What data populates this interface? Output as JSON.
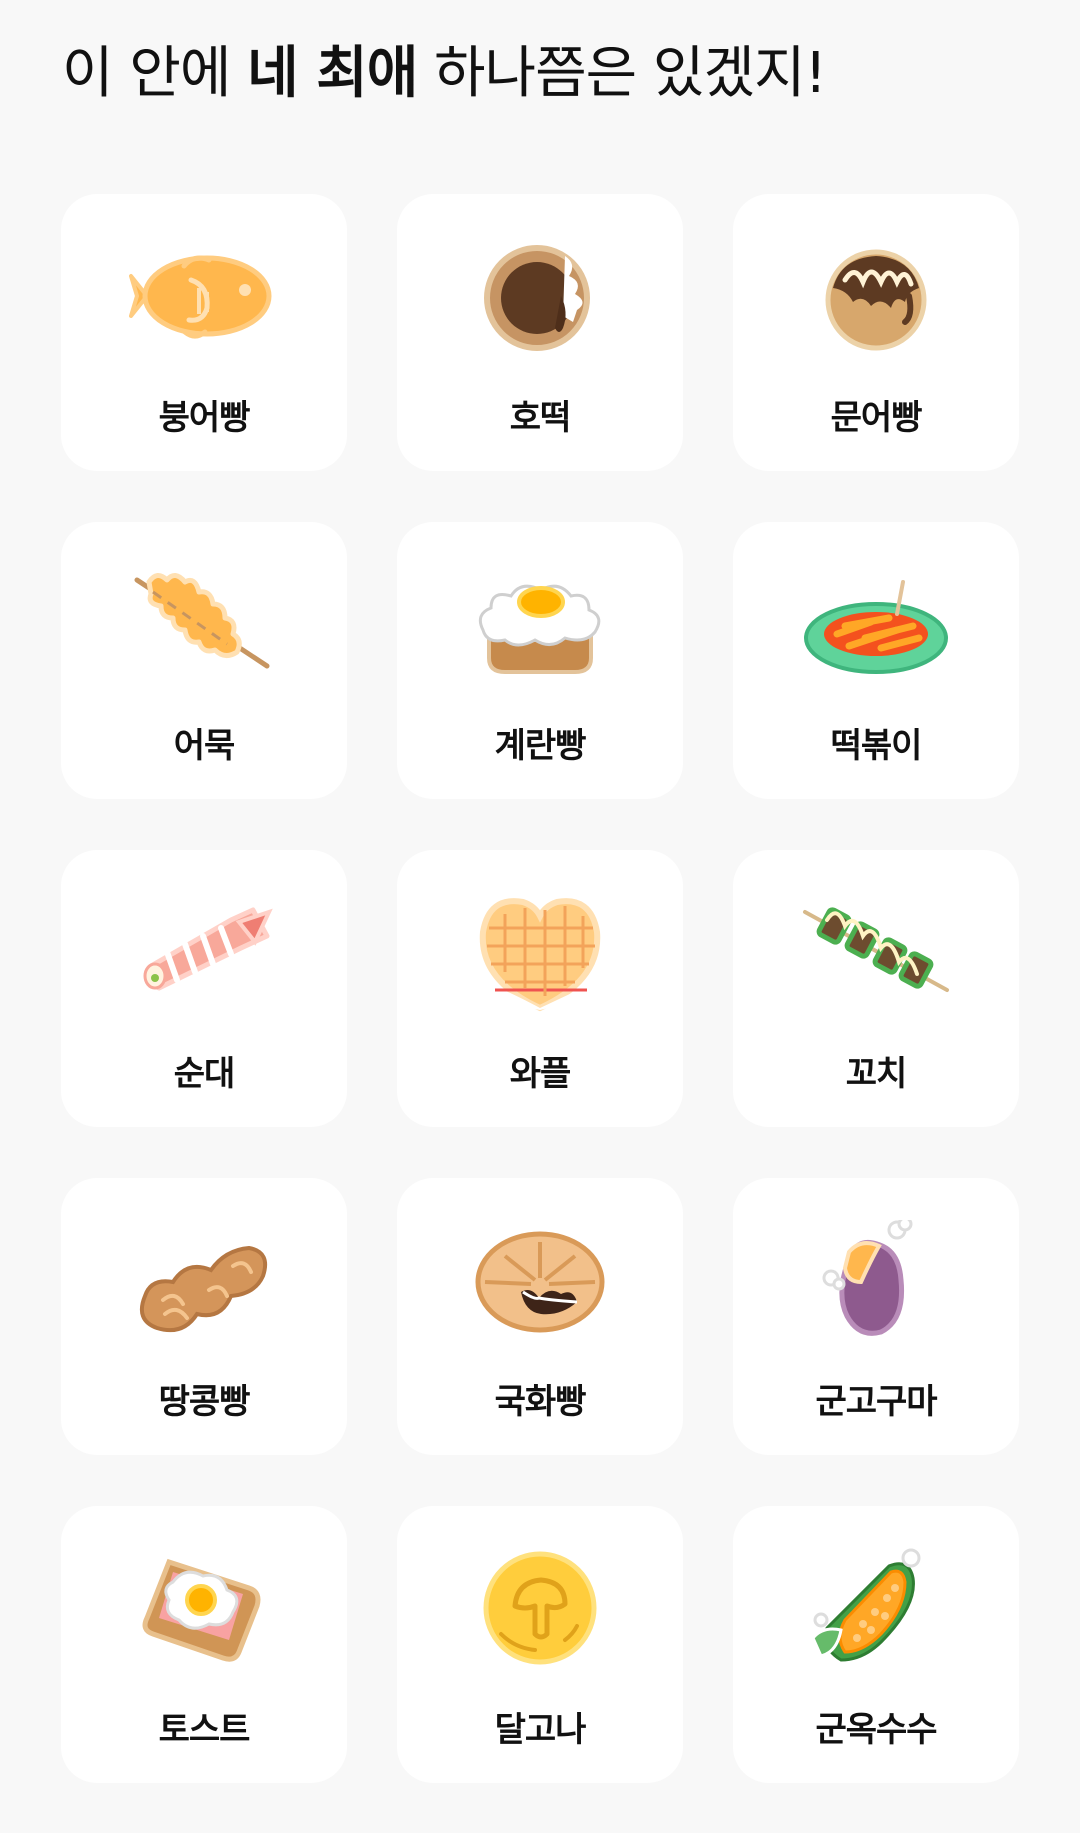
{
  "header": {
    "title_prefix": "이 안에 ",
    "title_bold": "네 최애",
    "title_suffix": " 하나쯤은 있겠지!"
  },
  "items": [
    {
      "label": "붕어빵",
      "icon": "fish-bread-icon"
    },
    {
      "label": "호떡",
      "icon": "hotteok-icon"
    },
    {
      "label": "문어빵",
      "icon": "takoyaki-icon"
    },
    {
      "label": "어묵",
      "icon": "fish-cake-skewer-icon"
    },
    {
      "label": "계란빵",
      "icon": "egg-bread-icon"
    },
    {
      "label": "떡볶이",
      "icon": "tteokbokki-icon"
    },
    {
      "label": "순대",
      "icon": "sundae-icon"
    },
    {
      "label": "와플",
      "icon": "waffle-icon"
    },
    {
      "label": "꼬치",
      "icon": "skewer-icon"
    },
    {
      "label": "땅콩빵",
      "icon": "peanut-bread-icon"
    },
    {
      "label": "국화빵",
      "icon": "chrysanthemum-bread-icon"
    },
    {
      "label": "군고구마",
      "icon": "roasted-sweet-potato-icon"
    },
    {
      "label": "토스트",
      "icon": "toast-icon"
    },
    {
      "label": "달고나",
      "icon": "dalgona-icon"
    },
    {
      "label": "군옥수수",
      "icon": "roasted-corn-icon"
    }
  ]
}
